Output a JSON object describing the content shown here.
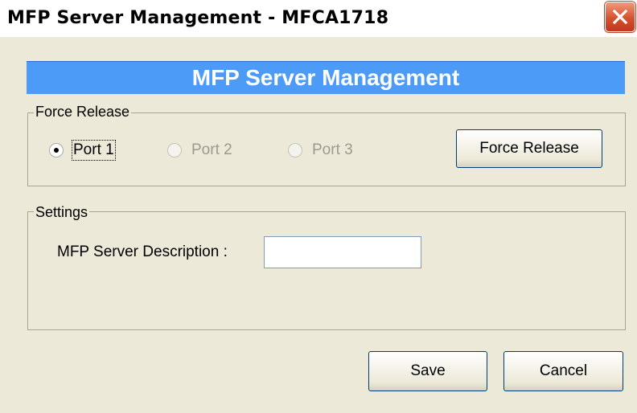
{
  "window": {
    "title": "MFP Server Management - MFCA1718"
  },
  "banner": {
    "text": "MFP Server Management"
  },
  "force_release": {
    "legend": "Force Release",
    "ports": [
      {
        "label": "Port 1",
        "checked": true,
        "enabled": true
      },
      {
        "label": "Port 2",
        "checked": false,
        "enabled": false
      },
      {
        "label": "Port 3",
        "checked": false,
        "enabled": false
      }
    ],
    "button_label": "Force Release"
  },
  "settings": {
    "legend": "Settings",
    "description_label": "MFP Server Description :",
    "description_value": ""
  },
  "footer": {
    "save_label": "Save",
    "cancel_label": "Cancel"
  }
}
